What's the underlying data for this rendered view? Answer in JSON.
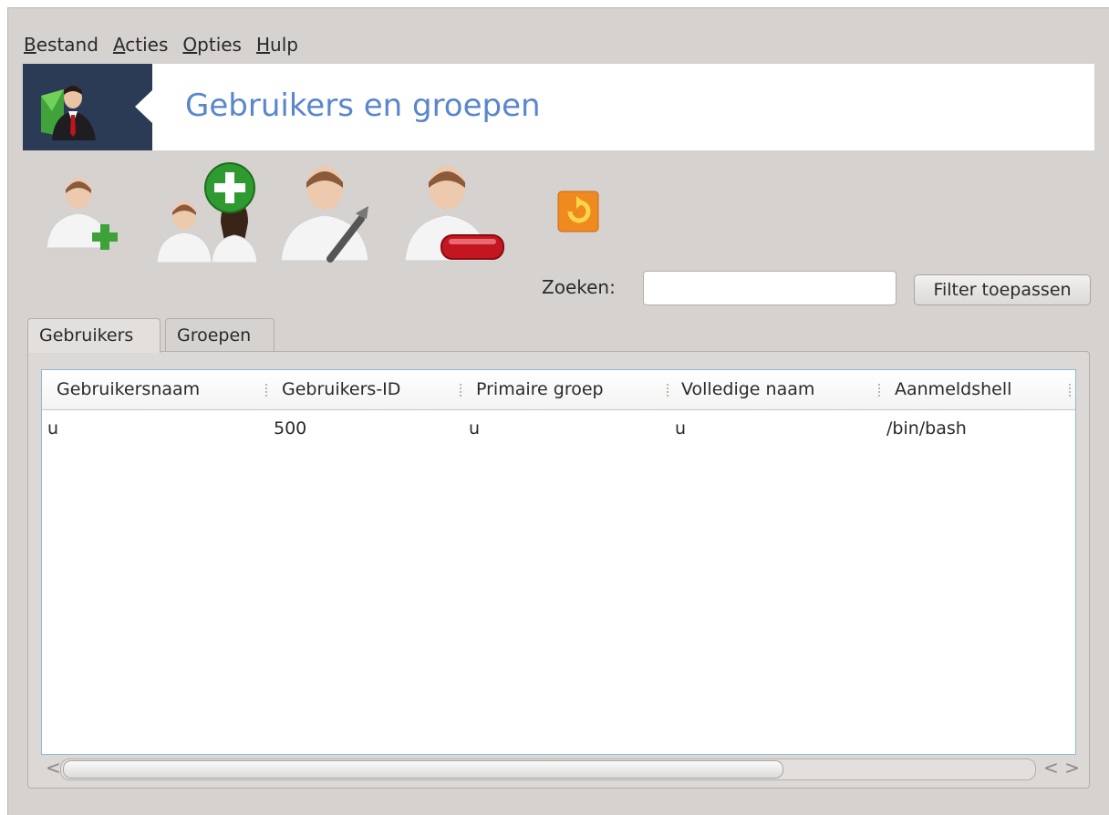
{
  "menu": [
    {
      "mnemonic": "B",
      "rest": "estand"
    },
    {
      "mnemonic": "A",
      "rest": "cties"
    },
    {
      "mnemonic": "O",
      "rest": "pties"
    },
    {
      "mnemonic": "H",
      "rest": "ulp"
    }
  ],
  "banner": {
    "title": "Gebruikers en groepen",
    "bg_color": "#2b3a55",
    "title_color": "#5a86cc"
  },
  "toolbar": [
    {
      "icon": "add-user-icon"
    },
    {
      "icon": "add-group-icon"
    },
    {
      "icon": "edit-user-icon"
    },
    {
      "icon": "delete-user-icon"
    },
    {
      "icon": "refresh-icon"
    }
  ],
  "search": {
    "label": "Zoeken:",
    "value": "",
    "filter_button": "Filter toepassen"
  },
  "tabs": [
    {
      "label": "Gebruikers",
      "active": true
    },
    {
      "label": "Groepen",
      "active": false
    }
  ],
  "table": {
    "columns": [
      "Gebruikersnaam",
      "Gebruikers-ID",
      "Primaire groep",
      "Volledige naam",
      "Aanmeldshell"
    ],
    "rows": [
      [
        "u",
        "500",
        "u",
        "u",
        "/bin/bash"
      ]
    ]
  },
  "scrollbar": {
    "left_arrow": "<",
    "right_arrows": "< >"
  }
}
